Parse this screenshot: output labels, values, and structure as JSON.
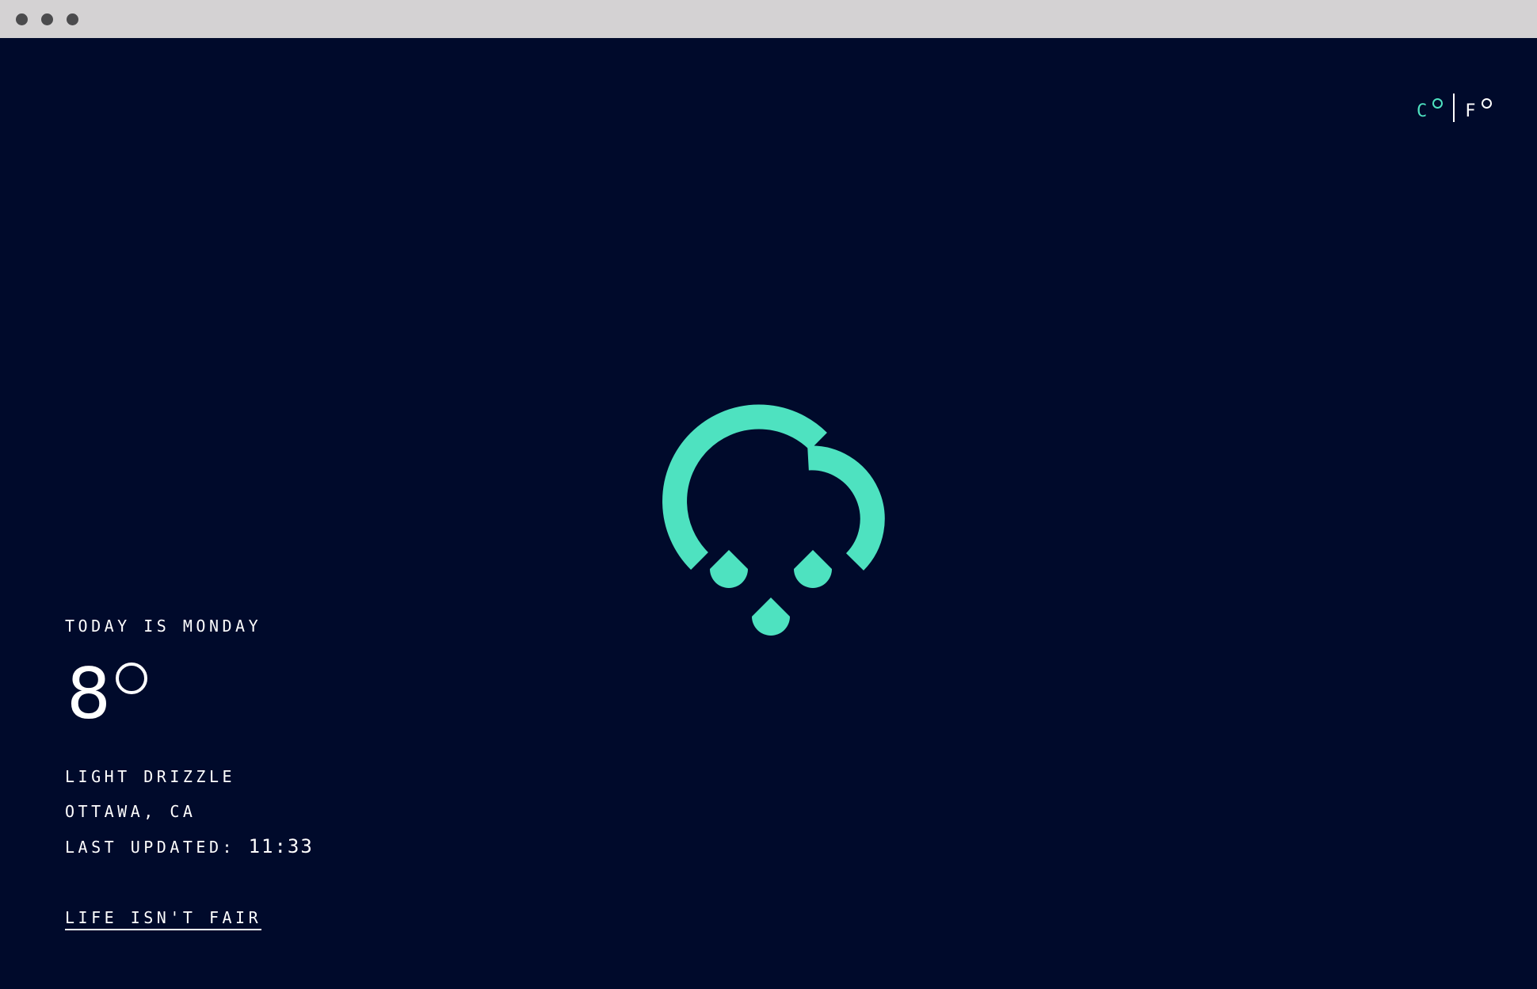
{
  "window": {
    "controls": [
      "close",
      "minimize",
      "maximize"
    ]
  },
  "units": {
    "celsius": "C",
    "fahrenheit": "F",
    "selected": "C"
  },
  "weather": {
    "icon": "cloud-drizzle-icon",
    "today_label": "TODAY IS MONDAY",
    "temperature": "8",
    "description": "LIGHT DRIZZLE",
    "location": "OTTAWA, CA",
    "updated_label": "LAST UPDATED: ",
    "updated_time": "11:33"
  },
  "link": {
    "label": "LIFE ISN'T FAIR"
  },
  "colors": {
    "background": "#000A2B",
    "accent": "#4EE2C0",
    "text": "#FFFFFF",
    "titlebar": "#D4D2D3"
  }
}
